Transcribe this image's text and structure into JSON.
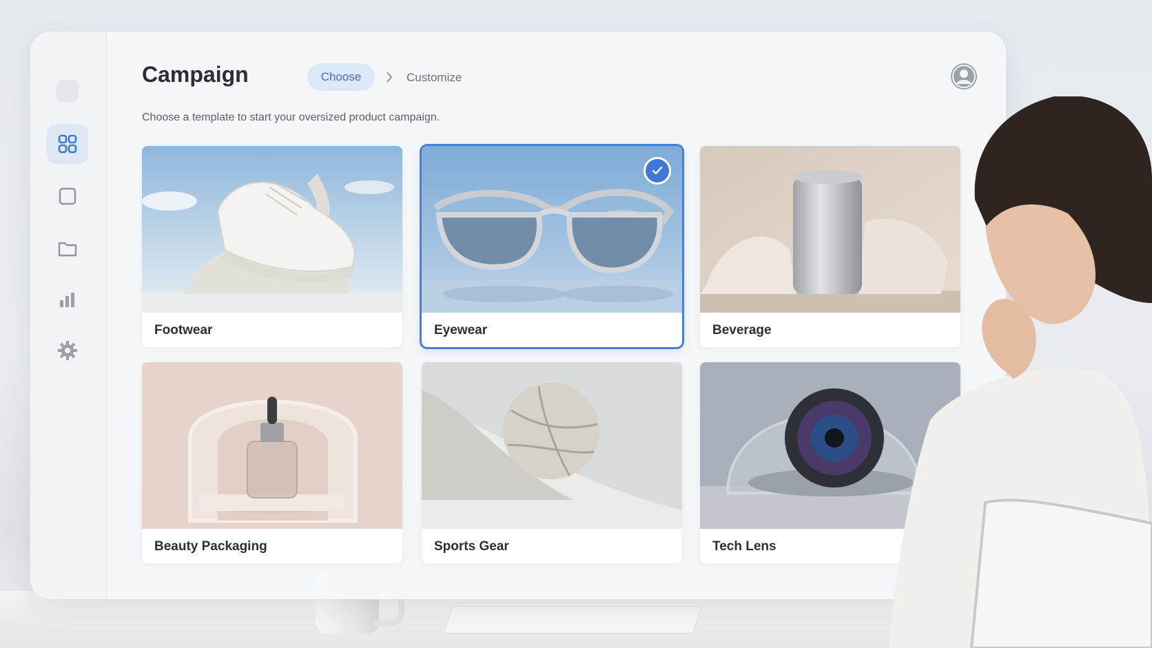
{
  "header": {
    "title": "Campaign",
    "steps": [
      {
        "label": "Choose",
        "active": true
      },
      {
        "label": "Customize",
        "active": false
      }
    ],
    "subtitle": "Choose a template to start your oversized product campaign."
  },
  "sidebar": {
    "items": [
      {
        "name": "logo",
        "icon": "rounded-square"
      },
      {
        "name": "templates",
        "icon": "grid-icon",
        "active": true
      },
      {
        "name": "canvas",
        "icon": "square-icon"
      },
      {
        "name": "files",
        "icon": "folder-icon"
      },
      {
        "name": "analytics",
        "icon": "bar-chart-icon"
      },
      {
        "name": "settings",
        "icon": "gear-icon"
      }
    ]
  },
  "templates": [
    {
      "label": "Footwear",
      "selected": false
    },
    {
      "label": "Eyewear",
      "selected": true
    },
    {
      "label": "Beverage",
      "selected": false
    },
    {
      "label": "Beauty Packaging",
      "selected": false
    },
    {
      "label": "Sports Gear",
      "selected": false
    },
    {
      "label": "Tech Lens",
      "selected": false
    }
  ],
  "colors": {
    "accent": "#3f78d8",
    "accent_soft": "#dde8f8",
    "text_primary": "#2a2e35",
    "text_secondary": "#5b6068"
  }
}
